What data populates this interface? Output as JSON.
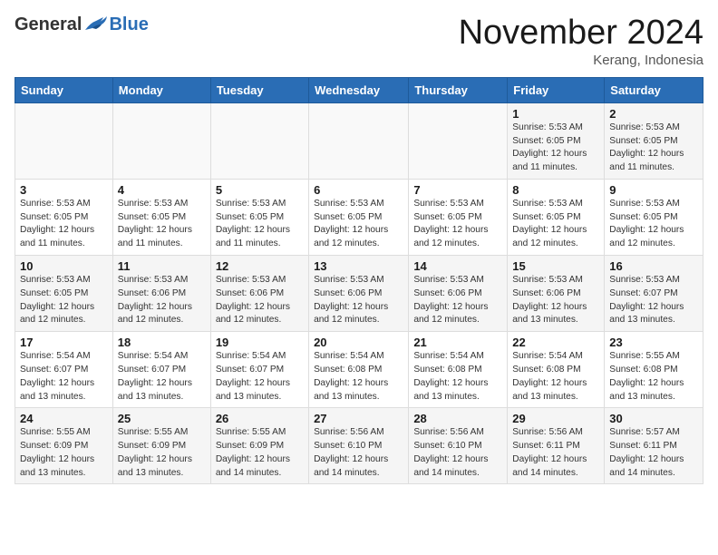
{
  "header": {
    "logo_general": "General",
    "logo_blue": "Blue",
    "month_title": "November 2024",
    "location": "Kerang, Indonesia"
  },
  "weekdays": [
    "Sunday",
    "Monday",
    "Tuesday",
    "Wednesday",
    "Thursday",
    "Friday",
    "Saturday"
  ],
  "weeks": [
    [
      {
        "day": "",
        "info": ""
      },
      {
        "day": "",
        "info": ""
      },
      {
        "day": "",
        "info": ""
      },
      {
        "day": "",
        "info": ""
      },
      {
        "day": "",
        "info": ""
      },
      {
        "day": "1",
        "info": "Sunrise: 5:53 AM\nSunset: 6:05 PM\nDaylight: 12 hours\nand 11 minutes."
      },
      {
        "day": "2",
        "info": "Sunrise: 5:53 AM\nSunset: 6:05 PM\nDaylight: 12 hours\nand 11 minutes."
      }
    ],
    [
      {
        "day": "3",
        "info": "Sunrise: 5:53 AM\nSunset: 6:05 PM\nDaylight: 12 hours\nand 11 minutes."
      },
      {
        "day": "4",
        "info": "Sunrise: 5:53 AM\nSunset: 6:05 PM\nDaylight: 12 hours\nand 11 minutes."
      },
      {
        "day": "5",
        "info": "Sunrise: 5:53 AM\nSunset: 6:05 PM\nDaylight: 12 hours\nand 11 minutes."
      },
      {
        "day": "6",
        "info": "Sunrise: 5:53 AM\nSunset: 6:05 PM\nDaylight: 12 hours\nand 12 minutes."
      },
      {
        "day": "7",
        "info": "Sunrise: 5:53 AM\nSunset: 6:05 PM\nDaylight: 12 hours\nand 12 minutes."
      },
      {
        "day": "8",
        "info": "Sunrise: 5:53 AM\nSunset: 6:05 PM\nDaylight: 12 hours\nand 12 minutes."
      },
      {
        "day": "9",
        "info": "Sunrise: 5:53 AM\nSunset: 6:05 PM\nDaylight: 12 hours\nand 12 minutes."
      }
    ],
    [
      {
        "day": "10",
        "info": "Sunrise: 5:53 AM\nSunset: 6:05 PM\nDaylight: 12 hours\nand 12 minutes."
      },
      {
        "day": "11",
        "info": "Sunrise: 5:53 AM\nSunset: 6:06 PM\nDaylight: 12 hours\nand 12 minutes."
      },
      {
        "day": "12",
        "info": "Sunrise: 5:53 AM\nSunset: 6:06 PM\nDaylight: 12 hours\nand 12 minutes."
      },
      {
        "day": "13",
        "info": "Sunrise: 5:53 AM\nSunset: 6:06 PM\nDaylight: 12 hours\nand 12 minutes."
      },
      {
        "day": "14",
        "info": "Sunrise: 5:53 AM\nSunset: 6:06 PM\nDaylight: 12 hours\nand 12 minutes."
      },
      {
        "day": "15",
        "info": "Sunrise: 5:53 AM\nSunset: 6:06 PM\nDaylight: 12 hours\nand 13 minutes."
      },
      {
        "day": "16",
        "info": "Sunrise: 5:53 AM\nSunset: 6:07 PM\nDaylight: 12 hours\nand 13 minutes."
      }
    ],
    [
      {
        "day": "17",
        "info": "Sunrise: 5:54 AM\nSunset: 6:07 PM\nDaylight: 12 hours\nand 13 minutes."
      },
      {
        "day": "18",
        "info": "Sunrise: 5:54 AM\nSunset: 6:07 PM\nDaylight: 12 hours\nand 13 minutes."
      },
      {
        "day": "19",
        "info": "Sunrise: 5:54 AM\nSunset: 6:07 PM\nDaylight: 12 hours\nand 13 minutes."
      },
      {
        "day": "20",
        "info": "Sunrise: 5:54 AM\nSunset: 6:08 PM\nDaylight: 12 hours\nand 13 minutes."
      },
      {
        "day": "21",
        "info": "Sunrise: 5:54 AM\nSunset: 6:08 PM\nDaylight: 12 hours\nand 13 minutes."
      },
      {
        "day": "22",
        "info": "Sunrise: 5:54 AM\nSunset: 6:08 PM\nDaylight: 12 hours\nand 13 minutes."
      },
      {
        "day": "23",
        "info": "Sunrise: 5:55 AM\nSunset: 6:08 PM\nDaylight: 12 hours\nand 13 minutes."
      }
    ],
    [
      {
        "day": "24",
        "info": "Sunrise: 5:55 AM\nSunset: 6:09 PM\nDaylight: 12 hours\nand 13 minutes."
      },
      {
        "day": "25",
        "info": "Sunrise: 5:55 AM\nSunset: 6:09 PM\nDaylight: 12 hours\nand 13 minutes."
      },
      {
        "day": "26",
        "info": "Sunrise: 5:55 AM\nSunset: 6:09 PM\nDaylight: 12 hours\nand 14 minutes."
      },
      {
        "day": "27",
        "info": "Sunrise: 5:56 AM\nSunset: 6:10 PM\nDaylight: 12 hours\nand 14 minutes."
      },
      {
        "day": "28",
        "info": "Sunrise: 5:56 AM\nSunset: 6:10 PM\nDaylight: 12 hours\nand 14 minutes."
      },
      {
        "day": "29",
        "info": "Sunrise: 5:56 AM\nSunset: 6:11 PM\nDaylight: 12 hours\nand 14 minutes."
      },
      {
        "day": "30",
        "info": "Sunrise: 5:57 AM\nSunset: 6:11 PM\nDaylight: 12 hours\nand 14 minutes."
      }
    ]
  ]
}
